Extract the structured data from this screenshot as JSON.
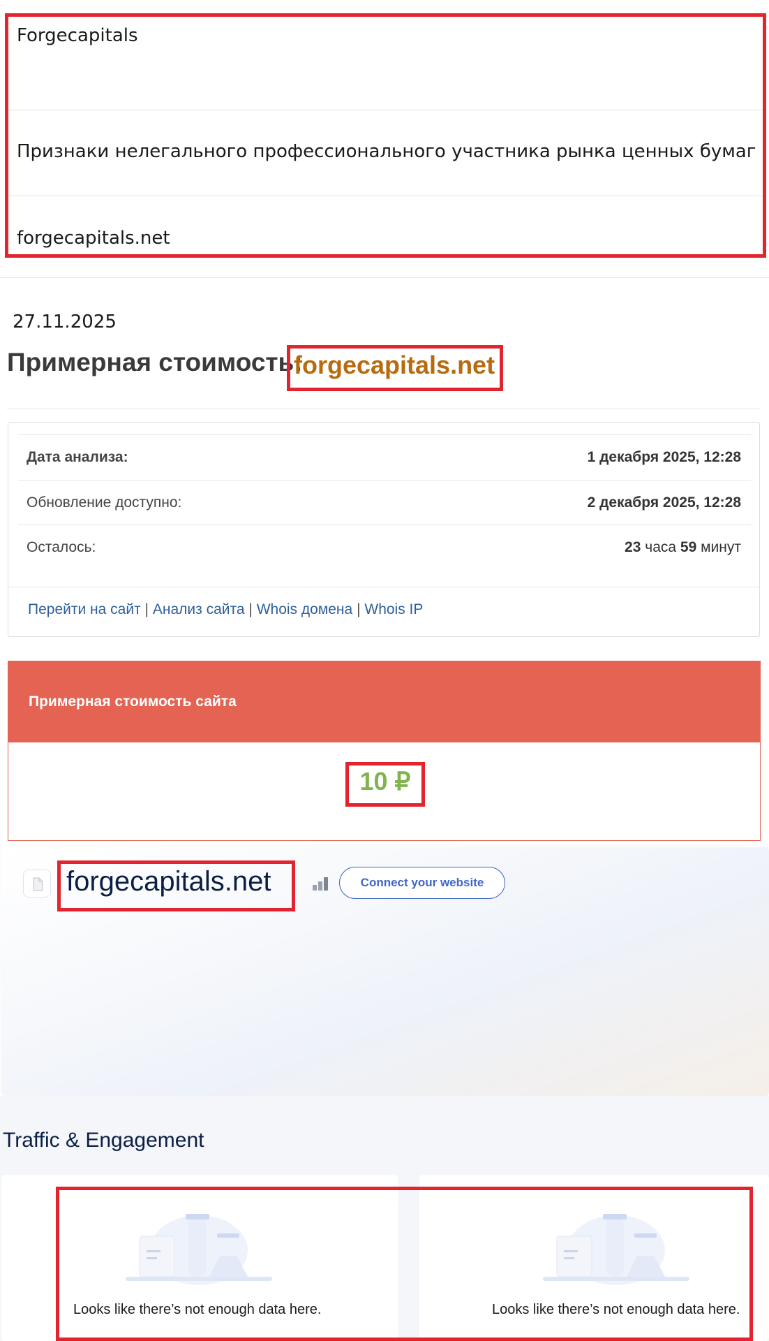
{
  "info_table": {
    "name": "Forgecapitals",
    "category": "Признаки нелегального профессионального участника рынка ценных бумаг",
    "domain": "forgecapitals.net"
  },
  "date": "27.11.2025",
  "estimate": {
    "title": "Примерная стоимость:",
    "domain": "forgecapitals.net"
  },
  "analysis": {
    "rows": [
      {
        "label": "Дата анализа:",
        "value": "1 декабря 2025, 12:28"
      },
      {
        "label": "Обновление доступно:",
        "value": "2 декабря 2025, 12:28"
      },
      {
        "label": "Осталось:",
        "hours": "23",
        "hours_unit": "часа",
        "minutes": "59",
        "minutes_unit": "минут"
      }
    ],
    "links": [
      "Перейти на сайт",
      "Анализ сайта",
      "Whois домена",
      "Whois IP"
    ],
    "link_separator": "|"
  },
  "price": {
    "header": "Примерная стоимость сайта",
    "value": "10 ₽"
  },
  "site_card": {
    "domain": "forgecapitals.net",
    "connect_label": "Connect your website"
  },
  "traffic": {
    "title": "Traffic & Engagement",
    "empty_message_1": "Looks like there’s not enough data here.",
    "empty_message_2": "Looks like there’s not enough data here."
  },
  "colors": {
    "highlight_border": "#e3232d",
    "price_header": "#e56352",
    "price_value": "#82b350",
    "estimate_domain": "#b86a0e",
    "link": "#2e5f98",
    "connect": "#3f66c9"
  }
}
